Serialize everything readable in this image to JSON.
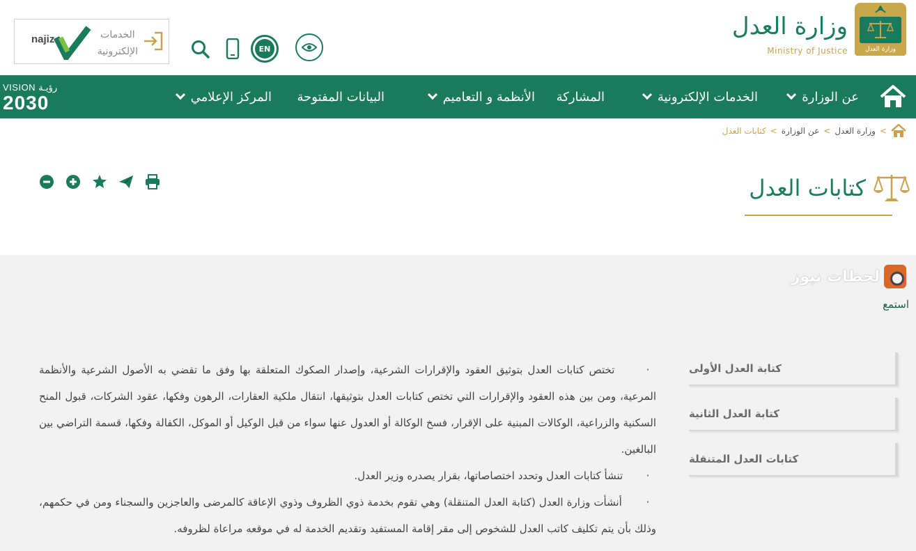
{
  "header": {
    "logo_ar": "وزارة العدل",
    "logo_en": "Ministry of Justice",
    "emblem_text": "وزارة العدل",
    "en_label": "EN",
    "eservices_line1": "الخدمات",
    "eservices_line2": "الإلكترونية",
    "najiz_label": "najiz"
  },
  "nav": {
    "items": [
      {
        "label": "عن الوزارة",
        "dropdown": true
      },
      {
        "label": "الخدمات الإلكترونية",
        "dropdown": true
      },
      {
        "label": "المشاركة",
        "dropdown": false
      },
      {
        "label": "الأنظمة و التعاميم",
        "dropdown": true
      },
      {
        "label": "البيانات المفتوحة",
        "dropdown": false
      },
      {
        "label": "المركز الإعلامي",
        "dropdown": true
      }
    ],
    "vision_top": "VISION رؤيـة",
    "vision_year": "2030"
  },
  "breadcrumb": {
    "items": [
      "وزارة العدل",
      "عن الوزارة"
    ],
    "current": "كتابات العدل",
    "separator": ">"
  },
  "page": {
    "title": "كتابات العدل"
  },
  "content": {
    "lahazat": "لحظات نيوز",
    "listen": "استمع",
    "side_menu": [
      "كتابة العدل الأولى",
      "كتابة العدل الثانية",
      "كتابات العدل المتنقلة"
    ],
    "paragraphs": [
      "تختص كتابات العدل بتوثيق العقود والإقرارات الشرعية، وإصدار الصكوك المتعلقة بها وفق ما تقضي به الأصول الشرعية والأنظمة المرعية، ومن بين هذه العقود والإقرارات التي تختص كتابات العدل بتوثيقها، انتقال ملكية العقارات، الرهون وفكها، عقود الشركات، قبول المنح السكنية والزراعية، الوكالات المبنية على الإقرار، فسخ الوكالة أو العدول عنها سواء من قبل الوكيل أو الموكل، الكفالة وفكها، قسمة التراضي بين البالغين.",
      "تنشأ كتابات العدل وتحدد اختصاصاتها، بقرار يصدره وزير العدل.",
      "أنشأت وزارة العدل (كتابة العدل المتنقلة) وهي تقوم بخدمة ذوي الظروف وذوي الإعاقة كالمرضى والعاجزين والسجناء ومن في حكمهم، وذلك بأن يتم تكليف كاتب العدل للشخوص إلى مقر إقامة المستفيد وتقديم الخدمة له في موقعه مراعاة لظروفه."
    ],
    "bullet": "·"
  },
  "colors": {
    "primary_green": "#1a7a5c",
    "gold": "#c9a24a",
    "content_bg": "#f2f2f2"
  }
}
